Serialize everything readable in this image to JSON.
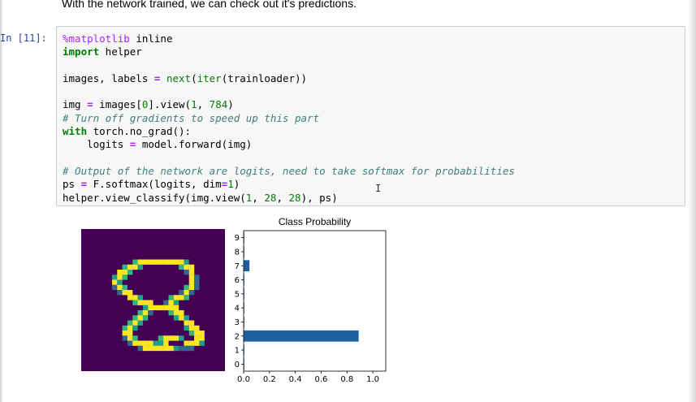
{
  "notebook": {
    "intro_text": "With the network trained, we can check out it's predictions.",
    "prompt": "In [11]:",
    "cursor_glyph": "I"
  },
  "code": {
    "lines": [
      "%matplotlib inline",
      "import helper",
      "",
      "images, labels = next(iter(trainloader))",
      "",
      "img = images[0].view(1, 784)",
      "# Turn off gradients to speed up this part",
      "with torch.no_grad():",
      "    logits = model.forward(img)",
      "",
      "# Output of the network are logits, need to take softmax for probabilities",
      "ps = F.softmax(logits, dim=1)",
      "helper.view_classify(img.view(1, 28, 28), ps)"
    ]
  },
  "output": {
    "image_colormap": "viridis",
    "digit_pixels": [
      "............................",
      "............................",
      "............................",
      "............................",
      "............................",
      "............................",
      "..........a#########b.......",
      "........a##b.......a##......",
      ".......##a..........c#......",
      "......b#a............#c.....",
      "......#b.............#c.....",
      "......c#a...........a#c.....",
      ".......c##.........c#c......",
      ".........##b.....a##a.......",
      "..........a###..c#b.........",
      "............b######.........",
      "...........a#c...a##........",
      "..........a#a.....b#b.......",
      ".........a#b........##......",
      "........a#b.........b##.....",
      "........##...........a##....",
      "........c#a....a###b..##....",
      ".........c####bb#...###b....",
      "...........c######bccc......",
      "............................",
      "............................",
      "............................",
      "............................"
    ]
  },
  "chart_data": {
    "type": "bar",
    "orientation": "horizontal",
    "title": "Class Probability",
    "categories": [
      "0",
      "1",
      "2",
      "3",
      "4",
      "5",
      "6",
      "7",
      "8",
      "9"
    ],
    "values": [
      0.005,
      0.002,
      0.89,
      0.001,
      0.001,
      0.001,
      0.005,
      0.045,
      0.001,
      0.001
    ],
    "xlim": [
      0,
      1.1
    ],
    "xticks": [
      "0.0",
      "0.2",
      "0.4",
      "0.6",
      "0.8",
      "1.0"
    ],
    "ylim": [
      -0.5,
      9.5
    ],
    "bar_color": "#1f5f9f",
    "grid": false,
    "xlabel": "",
    "ylabel": ""
  }
}
